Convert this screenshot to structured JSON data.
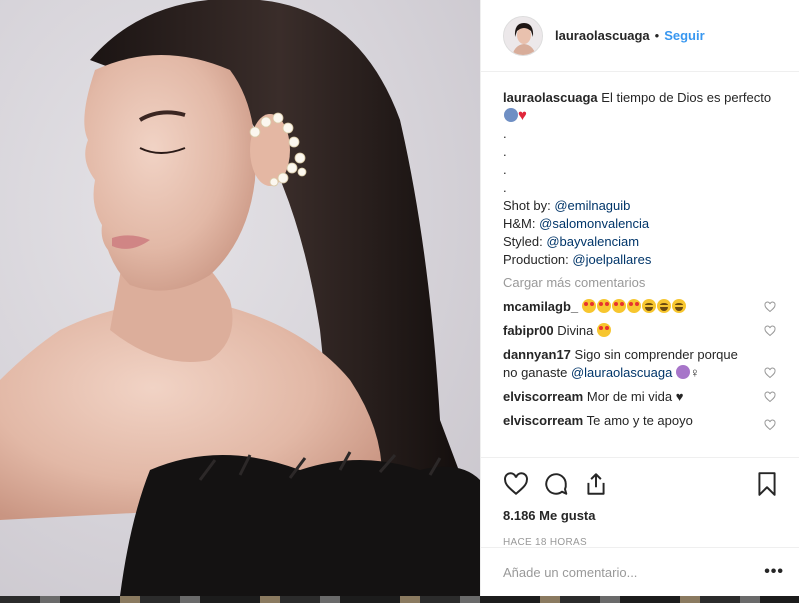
{
  "header": {
    "username": "lauraolascuaga",
    "separator": "•",
    "follow_label": "Seguir"
  },
  "caption": {
    "username": "lauraolascuaga",
    "text": "El tiempo de Dios es perfecto",
    "dots": [
      ".",
      ".",
      ".",
      "."
    ],
    "credits": [
      {
        "label": "Shot by: ",
        "mention": "@emilnaguib"
      },
      {
        "label": "H&M: ",
        "mention": "@salomonvalencia"
      },
      {
        "label": "Styled: ",
        "mention": "@bayvalenciam"
      },
      {
        "label": "Production: ",
        "mention": "@joelpallares"
      }
    ]
  },
  "load_more_label": "Cargar más comentarios",
  "comments": [
    {
      "username": "mcamilagb_",
      "text": ""
    },
    {
      "username": "fabipr00",
      "text": "Divina"
    },
    {
      "username": "dannyan17",
      "text": "Sigo sin comprender porque no ganaste ",
      "mention": "@lauraolascuaga",
      "suffix": "♀"
    },
    {
      "username": "elviscorream",
      "text": "Mor de mi vida"
    },
    {
      "username": "elviscorream",
      "text": "Te amo y te apoyo"
    }
  ],
  "actions": {
    "likes": "8.186 Me gusta",
    "timestamp": "HACE 18 HORAS"
  },
  "add_comment": {
    "placeholder": "Añade un comentario...",
    "more_label": "•••"
  },
  "icons": [
    "heart-icon",
    "comment-icon",
    "share-icon",
    "bookmark-icon",
    "heart-small-icon"
  ],
  "colors": {
    "link": "#003569",
    "follow": "#3897f0",
    "muted": "#999999"
  }
}
